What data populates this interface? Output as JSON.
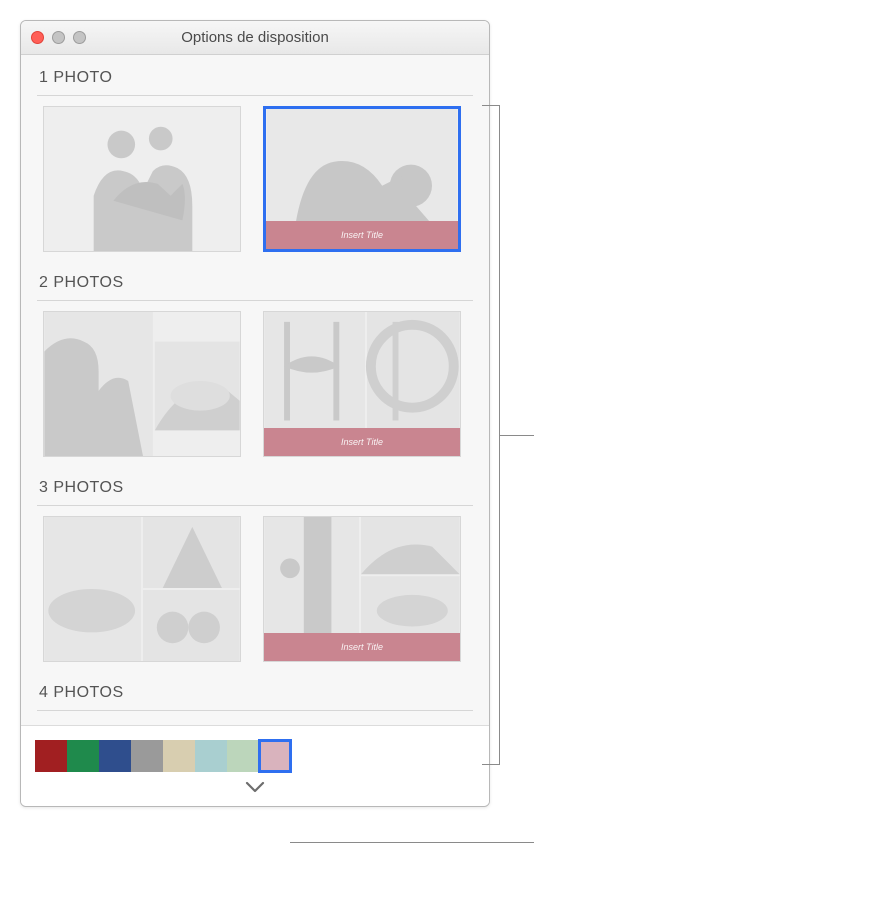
{
  "window": {
    "title": "Options de disposition"
  },
  "sections": {
    "s1": "1 PHOTO",
    "s2": "2 PHOTOS",
    "s3": "3 PHOTOS",
    "s4": "4 PHOTOS"
  },
  "caption_placeholder": "Insert Title",
  "colors": [
    "#a11f21",
    "#1f8a4c",
    "#2f4e8d",
    "#9a9a9a",
    "#d8ceb0",
    "#a9cfd0",
    "#bcd6bb",
    "#d9b3bd"
  ],
  "selected_color_index": 7,
  "selected_layout": "1-photo-b"
}
